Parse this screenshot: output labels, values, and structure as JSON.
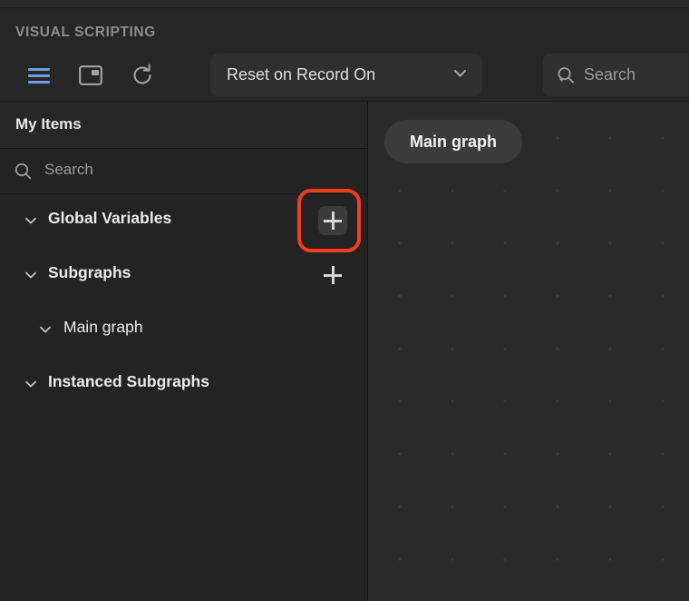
{
  "window": {
    "title": "VISUAL SCRIPTING"
  },
  "toolbar": {
    "hamburger_icon": "hamburger-menu-icon",
    "overlay_icon": "overlay-window-icon",
    "refresh_icon": "refresh-icon",
    "dropdown": {
      "value": "Reset on Record On",
      "chevron_icon": "chevron-down-icon"
    },
    "search": {
      "placeholder": "Search",
      "value": "",
      "icon": "search-icon"
    },
    "accent_blue": "#6e9de6"
  },
  "left_panel": {
    "header_title": "My Items",
    "search": {
      "placeholder": "Search",
      "value": "",
      "icon": "search-icon"
    },
    "tree": [
      {
        "label": "Global Variables",
        "depth": 0,
        "type": "group",
        "expanded": true,
        "twisty_icon": "chevron-down-icon",
        "add_button": {
          "label": "+",
          "icon": "plus-icon",
          "highlighted": true,
          "hovered": true
        }
      },
      {
        "label": "Subgraphs",
        "depth": 0,
        "type": "group",
        "expanded": true,
        "twisty_icon": "chevron-down-icon",
        "add_button": {
          "label": "+",
          "icon": "plus-icon",
          "highlighted": false,
          "hovered": false
        }
      },
      {
        "label": "Main graph",
        "depth": 1,
        "type": "leaf",
        "expanded": true,
        "twisty_icon": "chevron-down-icon",
        "add_button": null
      },
      {
        "label": "Instanced Subgraphs",
        "depth": 0,
        "type": "group",
        "expanded": true,
        "twisty_icon": "chevron-down-icon",
        "add_button": null
      }
    ]
  },
  "canvas": {
    "breadcrumb_pill": "Main graph",
    "grid": "dot-grid"
  },
  "annotation": {
    "shape": "rounded-rectangle",
    "color": "#f23c20",
    "target": "global-variables-add-button"
  }
}
